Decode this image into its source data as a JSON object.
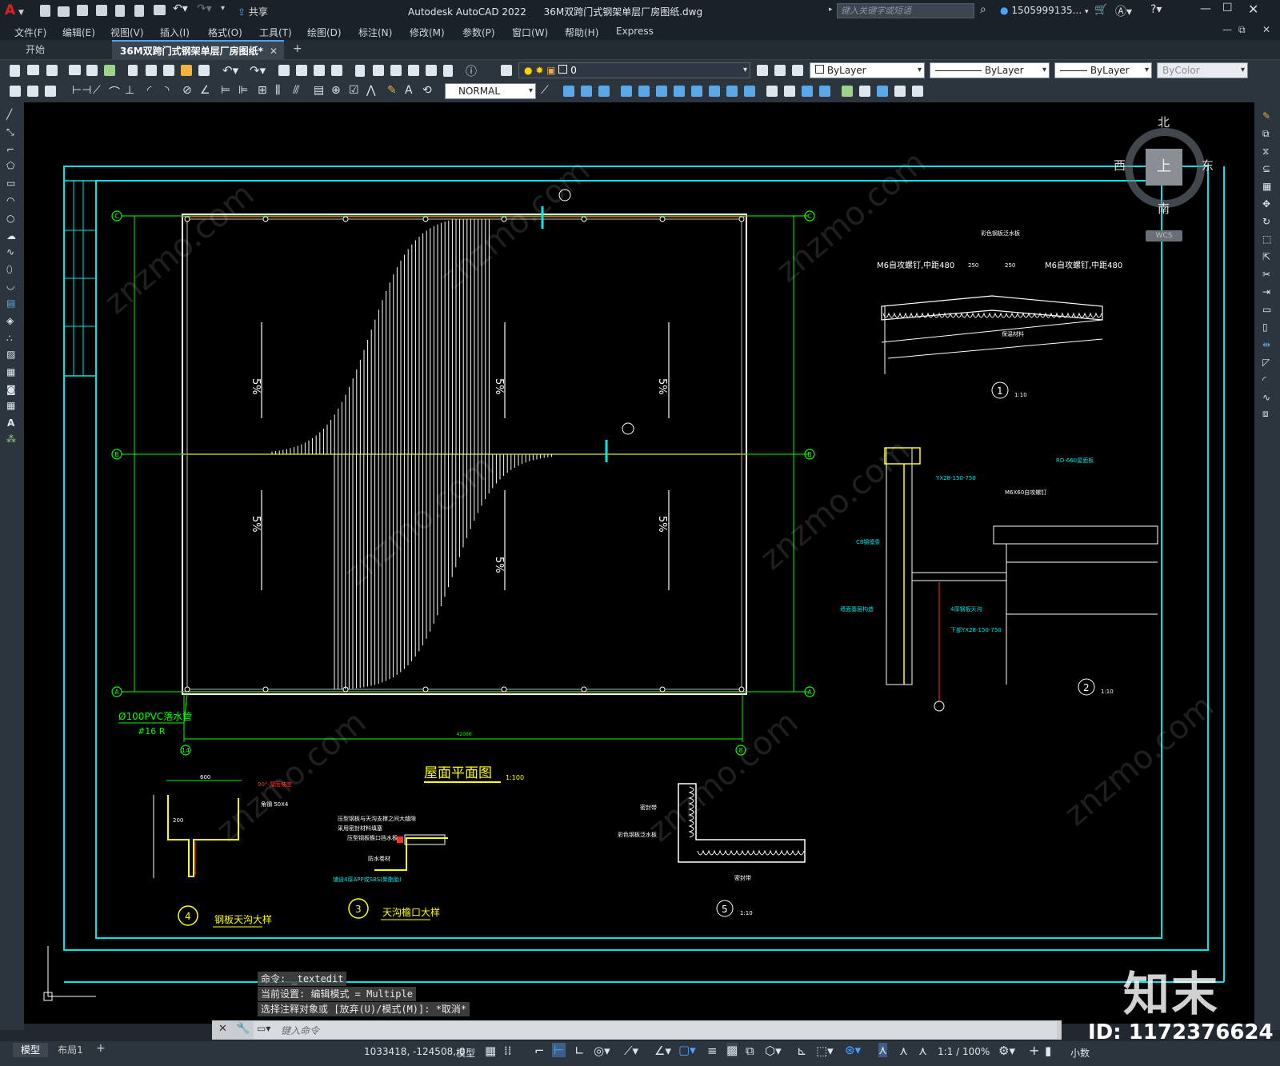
{
  "window": {
    "app_title": "Autodesk AutoCAD 2022",
    "file_title": "36M双跨门式钢架单层厂房图纸.dwg",
    "share_label": "共享",
    "search_placeholder": "键入关键字或短语",
    "user": "1505999135...",
    "app_letter": "A"
  },
  "menu": [
    "文件(F)",
    "编辑(E)",
    "视图(V)",
    "插入(I)",
    "格式(O)",
    "工具(T)",
    "绘图(D)",
    "标注(N)",
    "修改(M)",
    "参数(P)",
    "窗口(W)",
    "帮助(H)",
    "Express"
  ],
  "tabs": [
    {
      "label": "开始"
    },
    {
      "label": "36M双跨门式钢架单层厂房图纸*"
    }
  ],
  "toolbar": {
    "layer_value": "0",
    "color_value": "ByLayer",
    "linetype_value": "ByLayer",
    "lineweight_value": "ByLayer",
    "plotstyle_value": "ByColor",
    "textstyle_value": "NORMAL"
  },
  "viewcube": {
    "north": "北",
    "south": "南",
    "east": "东",
    "west": "西",
    "top": "上",
    "wcs": "WCS"
  },
  "drawing": {
    "plan_title": "屋面平面图",
    "plan_scale": "1:100",
    "slope": "5%",
    "pipe_note": "Ø100PVC落水管",
    "pipe_count": "#16 R",
    "dim_total": "42000",
    "axis_a": "A",
    "axis_b": "B",
    "axis_c": "C",
    "axis_14": "14",
    "axis_8": "8",
    "detail1_num": "1",
    "detail1_scale": "1:10",
    "detail2_num": "2",
    "detail2_scale": "1:10",
    "detail3_num": "3",
    "detail3_title": "天沟檐口大样",
    "detail4_num": "4",
    "detail4_title": "钢板天沟大样",
    "detail5_num": "5",
    "detail5_scale": "1:10",
    "d1_left": "M6自攻螺钉,中距480",
    "d1_right": "M6自攻螺钉,中距480",
    "d1_top": "彩色钢板泛水板",
    "d1_bottom": "保温材料",
    "d1_dim": "250",
    "d2_a": "YX28-150-750",
    "d2_b": "M6X60自攻螺钉",
    "d2_c": "RD-660屋面板",
    "d2_d": "C8钢檩条",
    "d2_e": "4厚钢板天沟",
    "d2_f": "下部YX28-150-750",
    "d2_g": "墙面基层构造",
    "d5_a": "密封带",
    "d5_b": "彩色钢板泛水板",
    "d5_c": "密封带",
    "d4_a": "90°-屋面坡度",
    "d4_b": "角钢 50X4",
    "d4_c": "600",
    "d4_d": "200",
    "d3_a": "压型钢板与天沟支撑之间大缝隙",
    "d3_b": "采用密封材料填塞",
    "d3_c": "压型钢板檐口挡水板",
    "d3_d": "防水卷材",
    "d3_e": "铺设4厚APP或SBS(聚酯胎)"
  },
  "command": {
    "line1": "命令: _textedit",
    "line2": "当前设置: 编辑模式 = Multiple",
    "line3": "选择注释对象或 [放弃(U)/模式(M)]: *取消*",
    "input_placeholder": "键入命令"
  },
  "status": {
    "coords": "1033418, -124508, 0",
    "model": "模型",
    "scale": "1:1 / 100%",
    "units": "小数"
  },
  "layout_tabs": [
    "模型",
    "布局1"
  ],
  "watermark": {
    "brand": "知末",
    "id": "ID: 1172376624",
    "site": "znzmo.com"
  },
  "colors": {
    "frame": "#00e5e5",
    "green": "#00ff00",
    "red": "#ff3030",
    "yellow": "#ffff00",
    "white": "#ffffff"
  }
}
